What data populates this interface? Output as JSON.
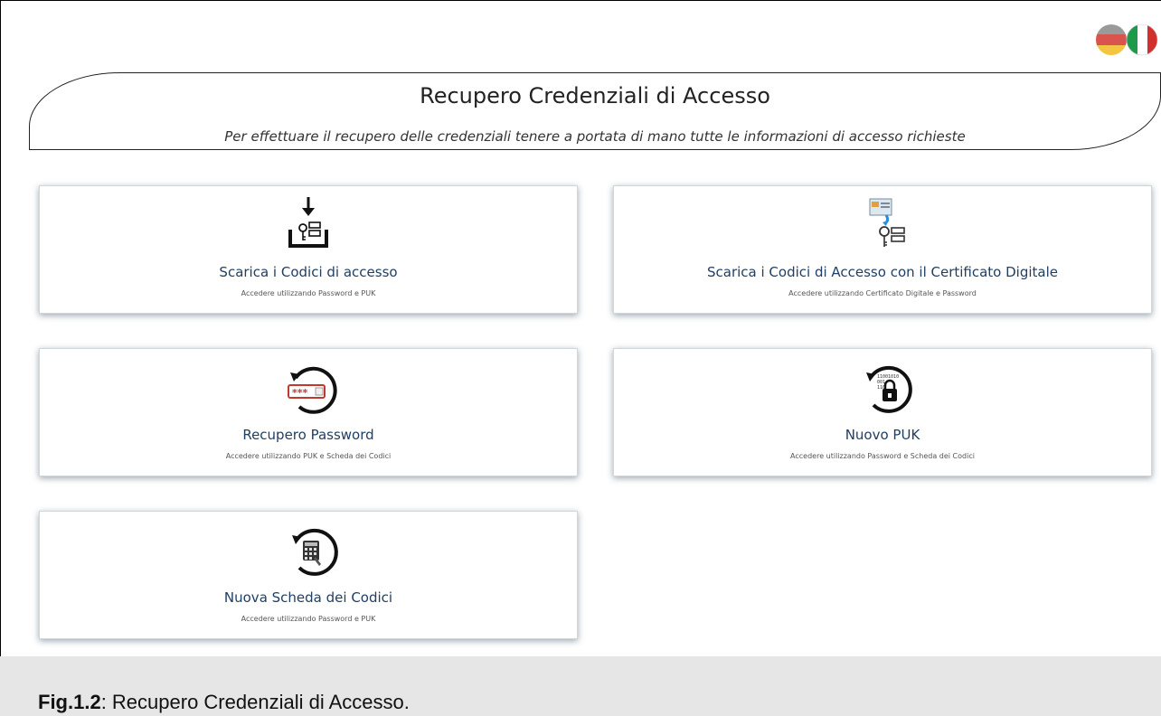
{
  "header": {
    "title": "Recupero Credenziali di Accesso",
    "subtitle": "Per effettuare il recupero delle credenziali tenere a portata di mano tutte le informazioni di accesso richieste"
  },
  "languages": [
    {
      "name": "german-flag-icon",
      "colors": [
        "#000000",
        "#dd0000",
        "#ffce00"
      ]
    },
    {
      "name": "italian-flag-icon",
      "colors": [
        "#009246",
        "#ffffff",
        "#ce2b37"
      ]
    }
  ],
  "tiles": [
    {
      "title": "Scarica i Codici di accesso",
      "desc": "Accedere utilizzando Password e PUK",
      "icon": "download-codes-icon"
    },
    {
      "title": "Scarica i Codici di Accesso con il Certificato Digitale",
      "desc": "Accedere utilizzando Certificato Digitale e Password",
      "icon": "certificate-key-icon"
    },
    {
      "title": "Recupero Password",
      "desc": "Accedere utilizzando PUK e Scheda dei Codici",
      "icon": "password-recovery-icon"
    },
    {
      "title": "Nuovo PUK",
      "desc": "Accedere utilizzando Password e Scheda dei Codici",
      "icon": "new-puk-lock-icon"
    },
    {
      "title": "Nuova Scheda dei Codici",
      "desc": "Accedere utilizzando Password e PUK",
      "icon": "new-code-card-icon"
    }
  ],
  "caption": {
    "label": "Fig.1.2",
    "text": ": Recupero Credenziali di Accesso."
  },
  "colors": {
    "tile_title": "#1f3f63",
    "caption_band": "#e6e6e6"
  }
}
